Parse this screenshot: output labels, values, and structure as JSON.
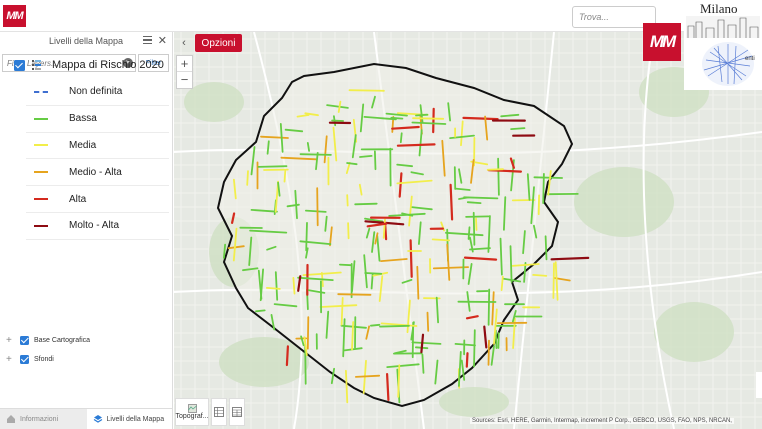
{
  "app": {
    "logo_text": "MM",
    "search_placeholder": "Trova..."
  },
  "sidebar": {
    "title": "Livelli della Mappa",
    "filter_placeholder": "Filter Layers...",
    "filter_button": "Filter",
    "main_layer": {
      "title": "Mappa di Rischio 2020",
      "checked": true
    },
    "legend": [
      {
        "label": "Non definita",
        "color": "#3f6fd0",
        "style": "dashed"
      },
      {
        "label": "Bassa",
        "color": "#66cc44",
        "style": "solid"
      },
      {
        "label": "Media",
        "color": "#f2ee4a",
        "style": "solid"
      },
      {
        "label": "Medio - Alta",
        "color": "#e6a41e",
        "style": "solid"
      },
      {
        "label": "Alta",
        "color": "#d42a1e",
        "style": "solid"
      },
      {
        "label": "Molto - Alta",
        "color": "#8e0b12",
        "style": "solid"
      }
    ],
    "sub_layers": [
      {
        "label": "Base Cartografica",
        "checked": true
      },
      {
        "label": "Sfondi",
        "checked": true
      }
    ],
    "tabs": [
      {
        "label": "Informazioni",
        "active": false
      },
      {
        "label": "Livelli della Mappa",
        "active": true
      }
    ]
  },
  "map": {
    "options_button": "Opzioni",
    "zoom_in": "+",
    "zoom_out": "−",
    "collapse_icon": "chevron-left-icon",
    "logo_text": "MM",
    "overview_title": "Milano",
    "overview_caption": "enti",
    "basemap_label": "Topograf...",
    "attribution": "Sources: Esri, HERE, Garmin, Intermap, increment P Corp., GEBCO, USGS, FAO, NPS, NRCAN,",
    "colors": {
      "boundary": "#111111",
      "brand_red": "#c8102e"
    }
  }
}
